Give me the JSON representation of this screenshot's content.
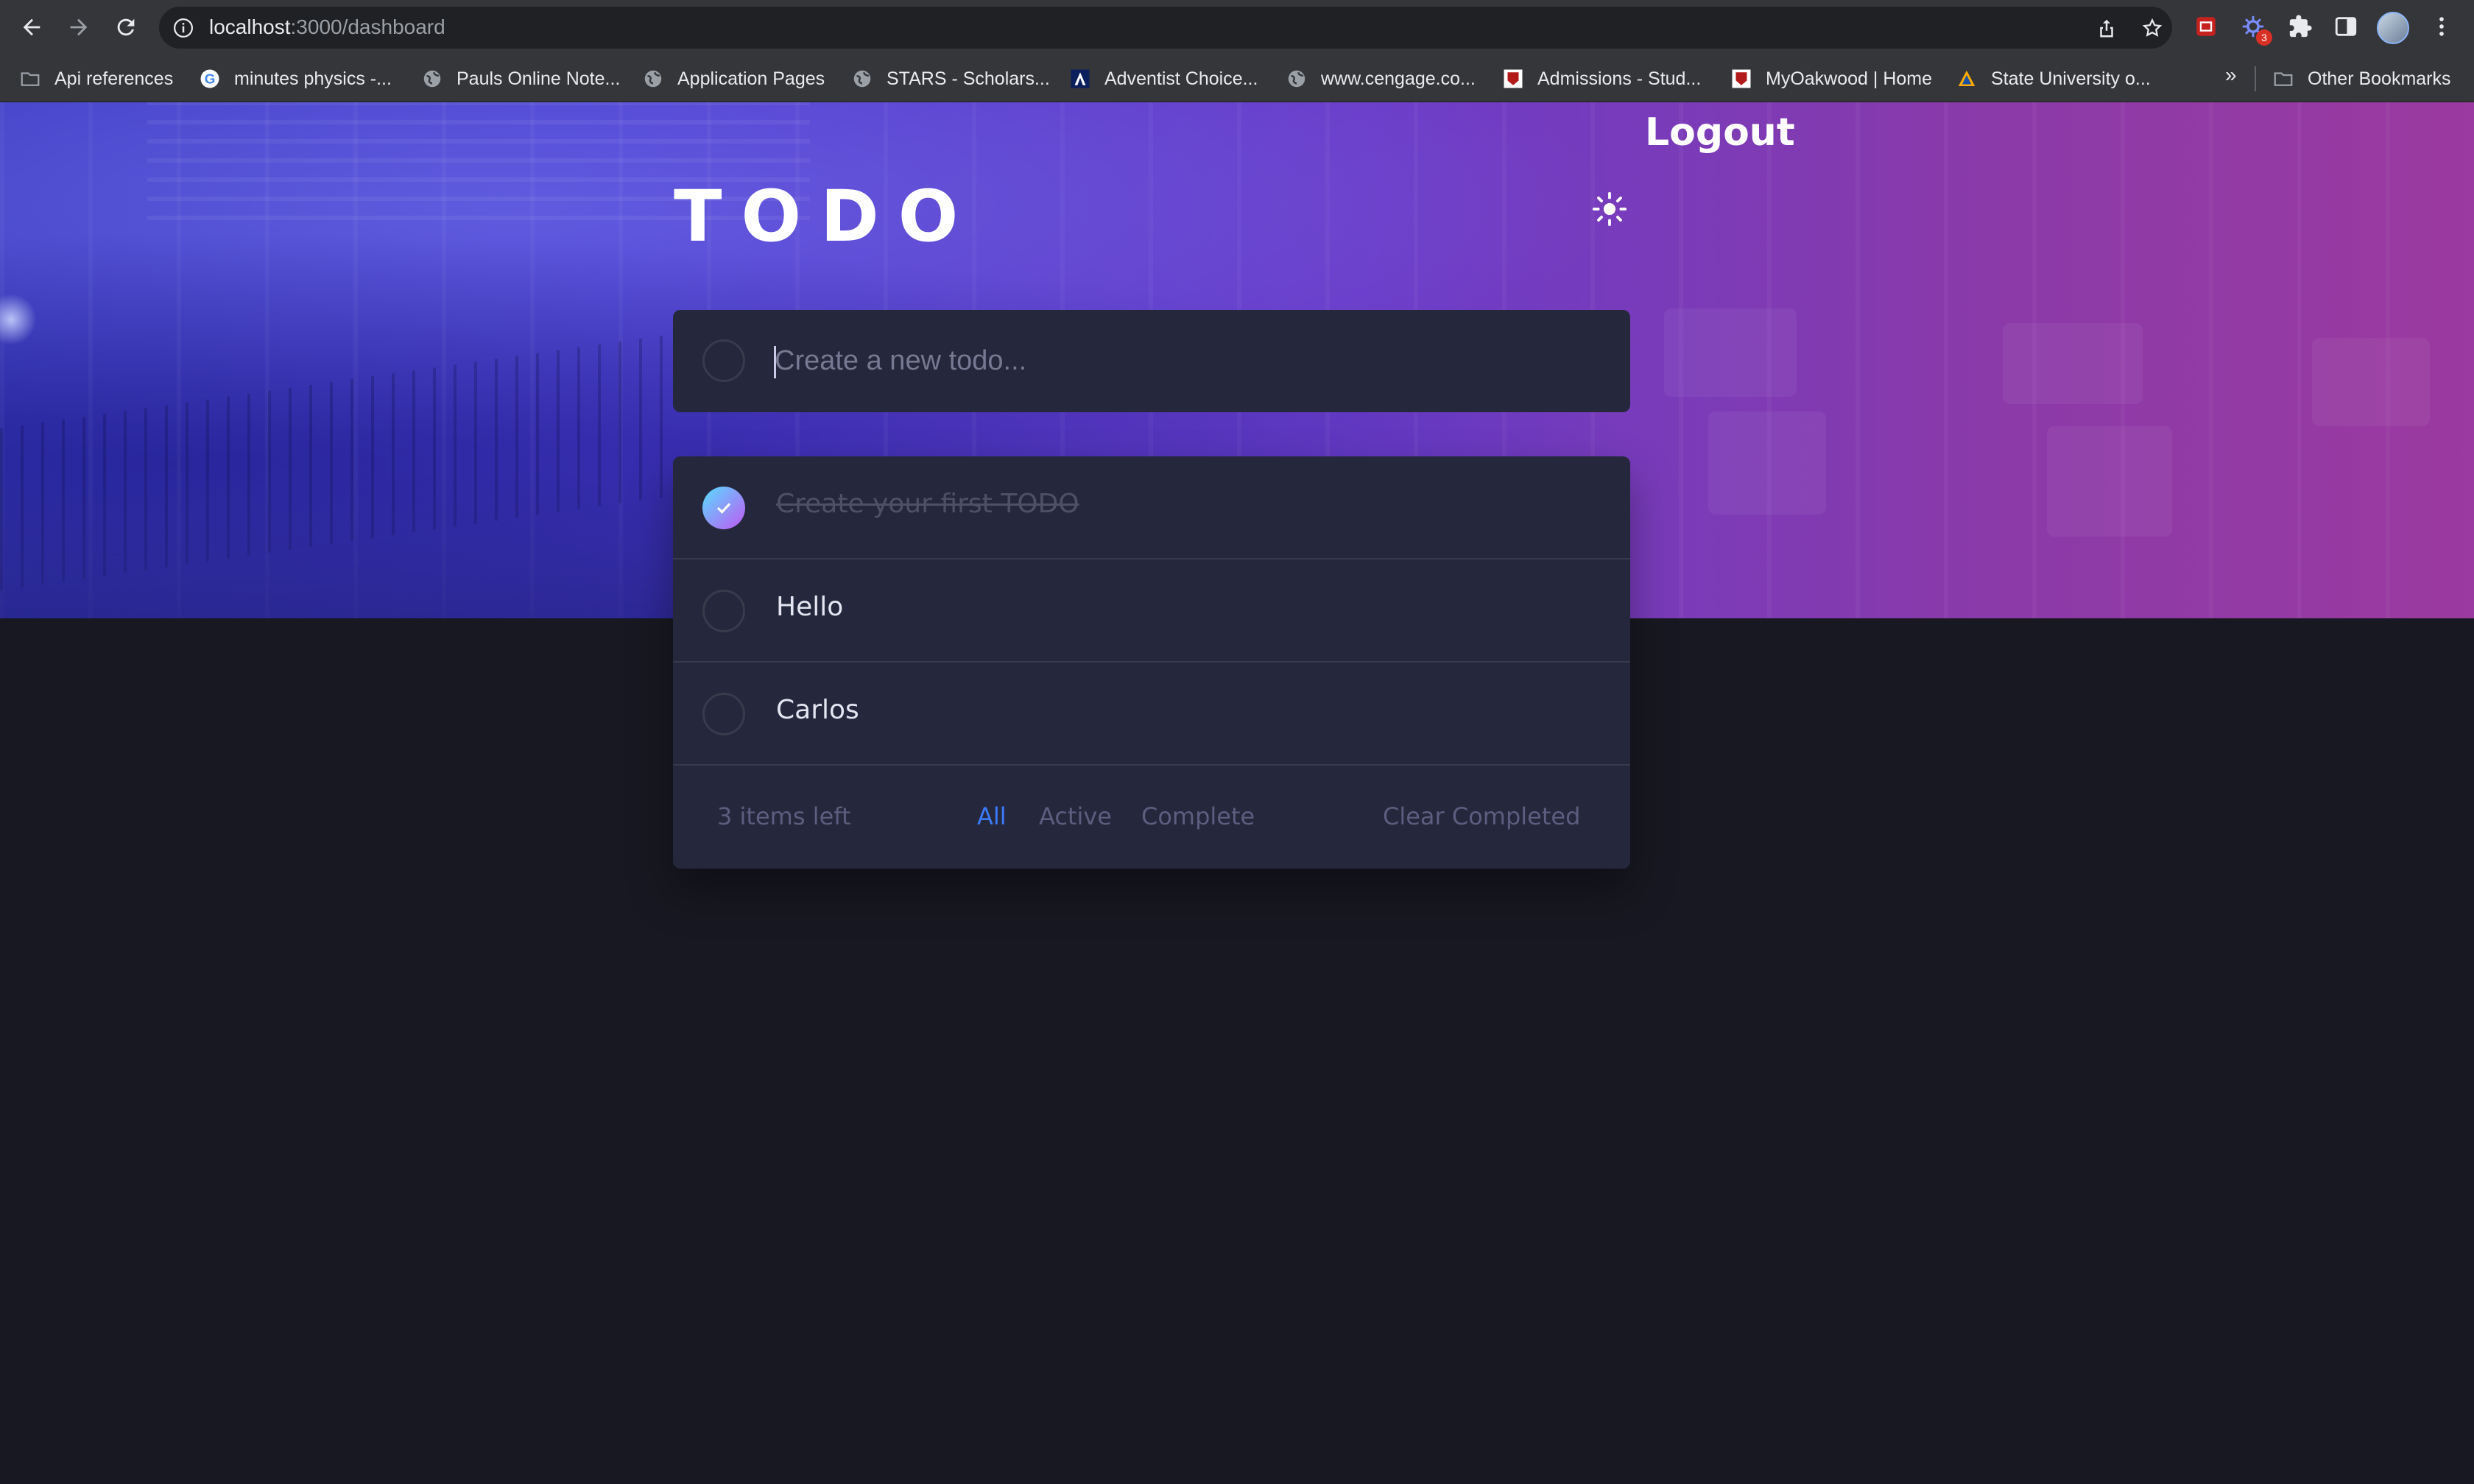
{
  "browser": {
    "url_host": "localhost",
    "url_path": ":3000/dashboard",
    "extension_badge": "3",
    "bookmarks": [
      {
        "label": "Api references",
        "icon": "folder-icon"
      },
      {
        "label": "minutes physics -...",
        "icon": "google-icon"
      },
      {
        "label": "Pauls Online Note...",
        "icon": "globe-icon"
      },
      {
        "label": "Application Pages",
        "icon": "globe-icon"
      },
      {
        "label": "STARS - Scholars...",
        "icon": "globe-icon"
      },
      {
        "label": "Adventist Choice...",
        "icon": "adventist-icon"
      },
      {
        "label": "www.cengage.co...",
        "icon": "globe-icon"
      },
      {
        "label": "Admissions - Stud...",
        "icon": "oakwood-icon"
      },
      {
        "label": "MyOakwood | Home",
        "icon": "oakwood-icon"
      },
      {
        "label": "State University o...",
        "icon": "state-university-icon"
      }
    ],
    "more_bookmarks": "»",
    "other_bookmarks": "Other Bookmarks"
  },
  "app": {
    "logout_label": "Logout",
    "title": "TODO",
    "theme_icon": "sun-icon",
    "new_todo_placeholder": "Create a new todo...",
    "todos": [
      {
        "text": "Create your first TODO",
        "completed": true
      },
      {
        "text": "Hello",
        "completed": false
      },
      {
        "text": "Carlos",
        "completed": false
      }
    ],
    "footer": {
      "items_left": "3 items left",
      "filters": [
        "All",
        "Active",
        "Complete"
      ],
      "active_filter": "All",
      "clear_completed": "Clear Completed"
    }
  },
  "colors": {
    "page_bg": "#171821",
    "card_bg": "#25273c",
    "accent": "#3a7bfd",
    "check_gradient_start": "#57ddff",
    "check_gradient_end": "#c058f3"
  }
}
